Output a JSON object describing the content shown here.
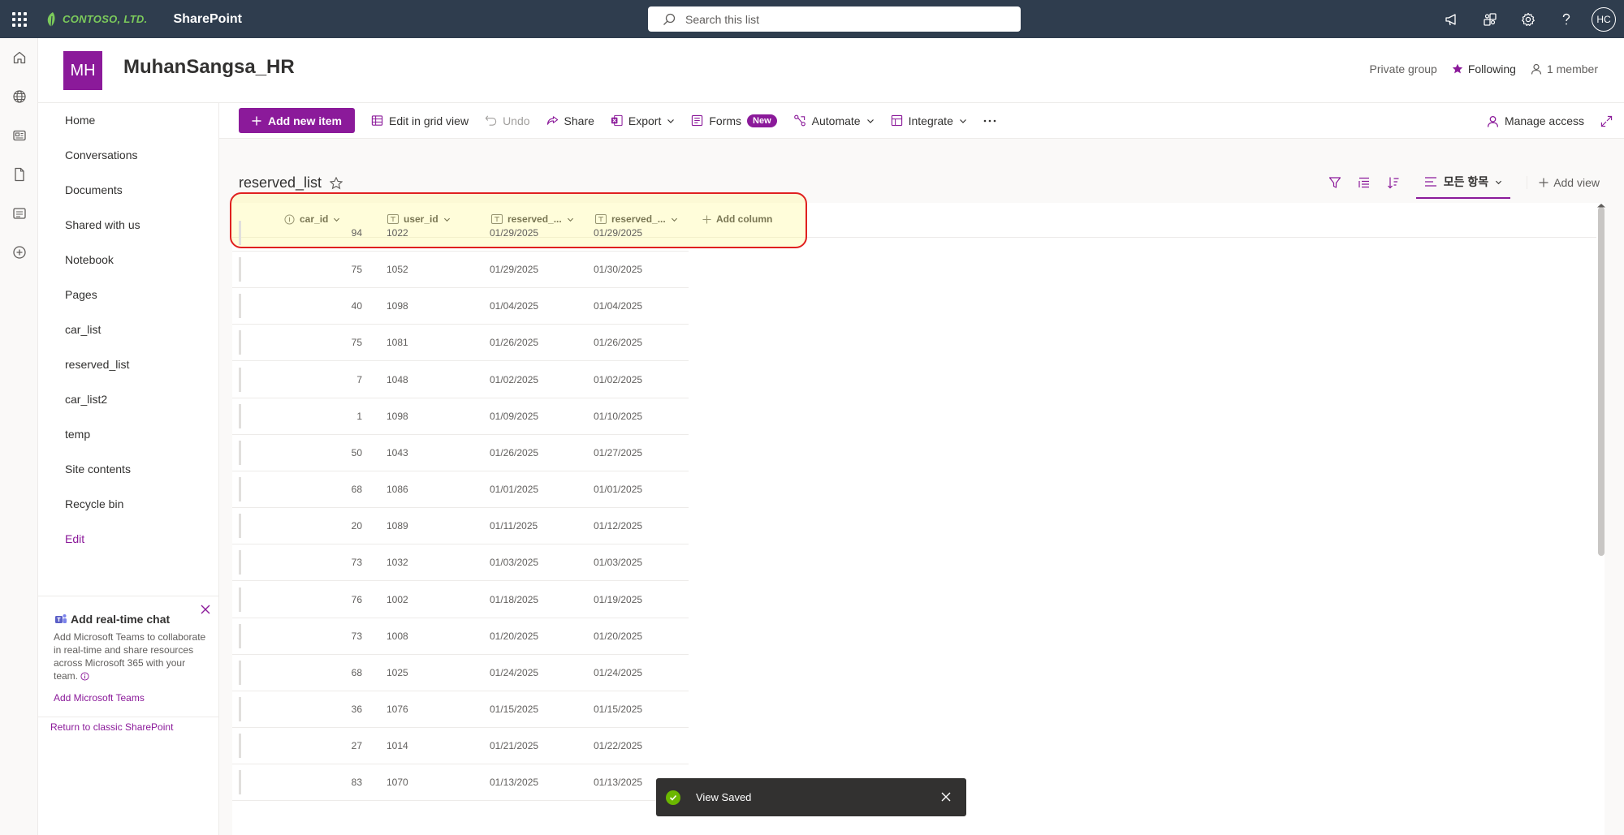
{
  "suite": {
    "brand": "CONTOSO, LTD.",
    "app_name": "SharePoint",
    "search_placeholder": "Search this list",
    "avatar_initials": "HC"
  },
  "site": {
    "logo_initials": "MH",
    "title": "MuhanSangsa_HR",
    "privacy": "Private group",
    "following": "Following",
    "members": "1 member"
  },
  "nav": {
    "items": [
      "Home",
      "Conversations",
      "Documents",
      "Shared with us",
      "Notebook",
      "Pages",
      "car_list",
      "reserved_list",
      "car_list2",
      "temp",
      "Site contents",
      "Recycle bin"
    ],
    "edit": "Edit",
    "chat_title": "Add real-time chat",
    "chat_desc": "Add Microsoft Teams to collaborate in real-time and share resources across Microsoft 365 with your team.",
    "chat_link": "Add Microsoft Teams",
    "classic_link": "Return to classic SharePoint"
  },
  "commands": {
    "add_new_item": "Add new item",
    "edit_grid": "Edit in grid view",
    "undo": "Undo",
    "share": "Share",
    "export": "Export",
    "forms": "Forms",
    "forms_badge": "New",
    "automate": "Automate",
    "integrate": "Integrate",
    "manage_access": "Manage access"
  },
  "list": {
    "title": "reserved_list",
    "view_name": "모든 항목",
    "add_view": "Add view",
    "columns": [
      "car_id",
      "user_id",
      "reserved_...",
      "reserved_..."
    ],
    "add_column": "Add column",
    "rows": [
      [
        "94",
        "1022",
        "01/29/2025",
        "01/29/2025"
      ],
      [
        "75",
        "1052",
        "01/29/2025",
        "01/30/2025"
      ],
      [
        "40",
        "1098",
        "01/04/2025",
        "01/04/2025"
      ],
      [
        "75",
        "1081",
        "01/26/2025",
        "01/26/2025"
      ],
      [
        "7",
        "1048",
        "01/02/2025",
        "01/02/2025"
      ],
      [
        "1",
        "1098",
        "01/09/2025",
        "01/10/2025"
      ],
      [
        "50",
        "1043",
        "01/26/2025",
        "01/27/2025"
      ],
      [
        "68",
        "1086",
        "01/01/2025",
        "01/01/2025"
      ],
      [
        "20",
        "1089",
        "01/11/2025",
        "01/12/2025"
      ],
      [
        "73",
        "1032",
        "01/03/2025",
        "01/03/2025"
      ],
      [
        "76",
        "1002",
        "01/18/2025",
        "01/19/2025"
      ],
      [
        "73",
        "1008",
        "01/20/2025",
        "01/20/2025"
      ],
      [
        "68",
        "1025",
        "01/24/2025",
        "01/24/2025"
      ],
      [
        "36",
        "1076",
        "01/15/2025",
        "01/15/2025"
      ],
      [
        "27",
        "1014",
        "01/21/2025",
        "01/22/2025"
      ],
      [
        "83",
        "1070",
        "01/13/2025",
        "01/13/2025"
      ]
    ]
  },
  "toast": {
    "message": "View Saved"
  },
  "colors": {
    "suitebar": "#2f3d4e",
    "accent": "#8b1a9a",
    "highlight_border": "#e02020",
    "success": "#6bb700"
  }
}
